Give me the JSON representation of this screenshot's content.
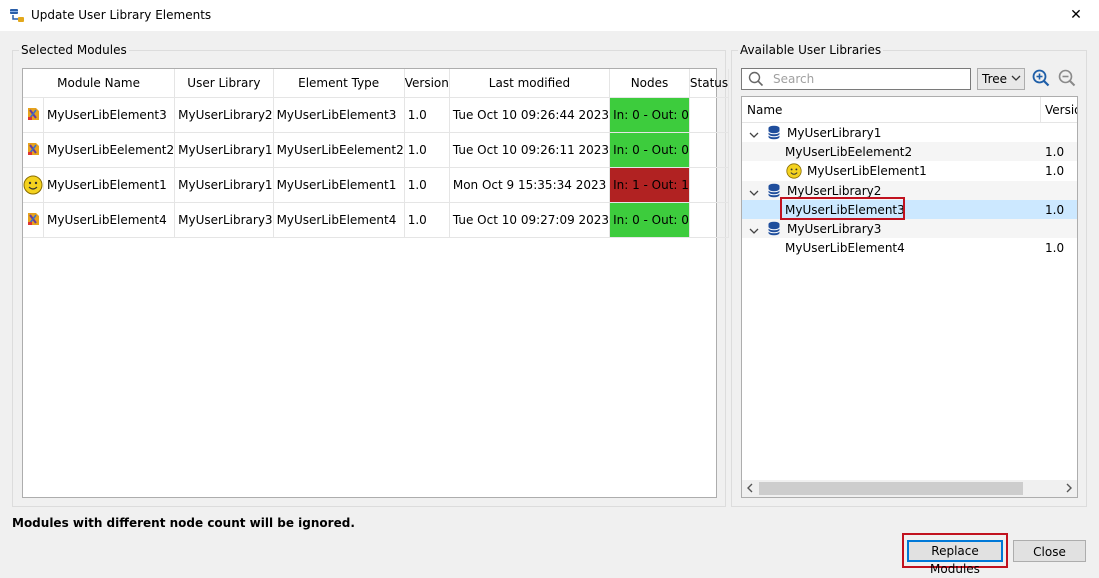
{
  "window": {
    "title": "Update User Library Elements",
    "close_glyph": "✕"
  },
  "left_panel": {
    "label": "Selected Modules",
    "columns": [
      "Module Name",
      "User Library",
      "Element Type",
      "Version",
      "Last modified",
      "Nodes",
      "Status"
    ],
    "rows": [
      {
        "icon": "module-icon",
        "name": "MyUserLibElement3",
        "library": "MyUserLibrary2",
        "type": "MyUserLibElement3",
        "version": "1.0",
        "modified": "Tue Oct 10 09:26:44 2023",
        "nodes": "In: 0 - Out: 0",
        "nodes_status": "ok",
        "status": ""
      },
      {
        "icon": "module-icon",
        "name": "MyUserLibEelement2",
        "library": "MyUserLibrary1",
        "type": "MyUserLibEelement2",
        "version": "1.0",
        "modified": "Tue Oct 10 09:26:11 2023",
        "nodes": "In: 0 - Out: 0",
        "nodes_status": "ok",
        "status": ""
      },
      {
        "icon": "smiley-icon",
        "name": "MyUserLibElement1",
        "library": "MyUserLibrary1",
        "type": "MyUserLibElement1",
        "version": "1.0",
        "modified": "Mon Oct 9 15:35:34 2023",
        "nodes": "In: 1 - Out: 1",
        "nodes_status": "bad",
        "status": ""
      },
      {
        "icon": "module-icon",
        "name": "MyUserLibElement4",
        "library": "MyUserLibrary3",
        "type": "MyUserLibElement4",
        "version": "1.0",
        "modified": "Tue Oct 10 09:27:09 2023",
        "nodes": "In: 0 - Out: 0",
        "nodes_status": "ok",
        "status": ""
      }
    ]
  },
  "right_panel": {
    "label": "Available User Libraries",
    "search_placeholder": "Search",
    "view_mode": "Tree",
    "header_name": "Name",
    "header_version": "Versio",
    "tree": [
      {
        "label": "MyUserLibrary1",
        "kind": "library",
        "version": ""
      },
      {
        "label": "MyUserLibEelement2",
        "kind": "element",
        "version": "1.0"
      },
      {
        "label": "MyUserLibElement1",
        "kind": "element-smiley",
        "version": "1.0"
      },
      {
        "label": "MyUserLibrary2",
        "kind": "library",
        "version": ""
      },
      {
        "label": "MyUserLibElement3",
        "kind": "element-selected",
        "version": "1.0"
      },
      {
        "label": "MyUserLibrary3",
        "kind": "library",
        "version": ""
      },
      {
        "label": "MyUserLibElement4",
        "kind": "element",
        "version": "1.0"
      }
    ]
  },
  "footer": {
    "warning": "Modules with different node count will be ignored.",
    "replace_label": "Replace Modules",
    "close_label": "Close"
  },
  "colors": {
    "ok": "#3dcc3d",
    "bad": "#b12222",
    "highlight": "#c1121f",
    "selection": "#cce8ff"
  }
}
